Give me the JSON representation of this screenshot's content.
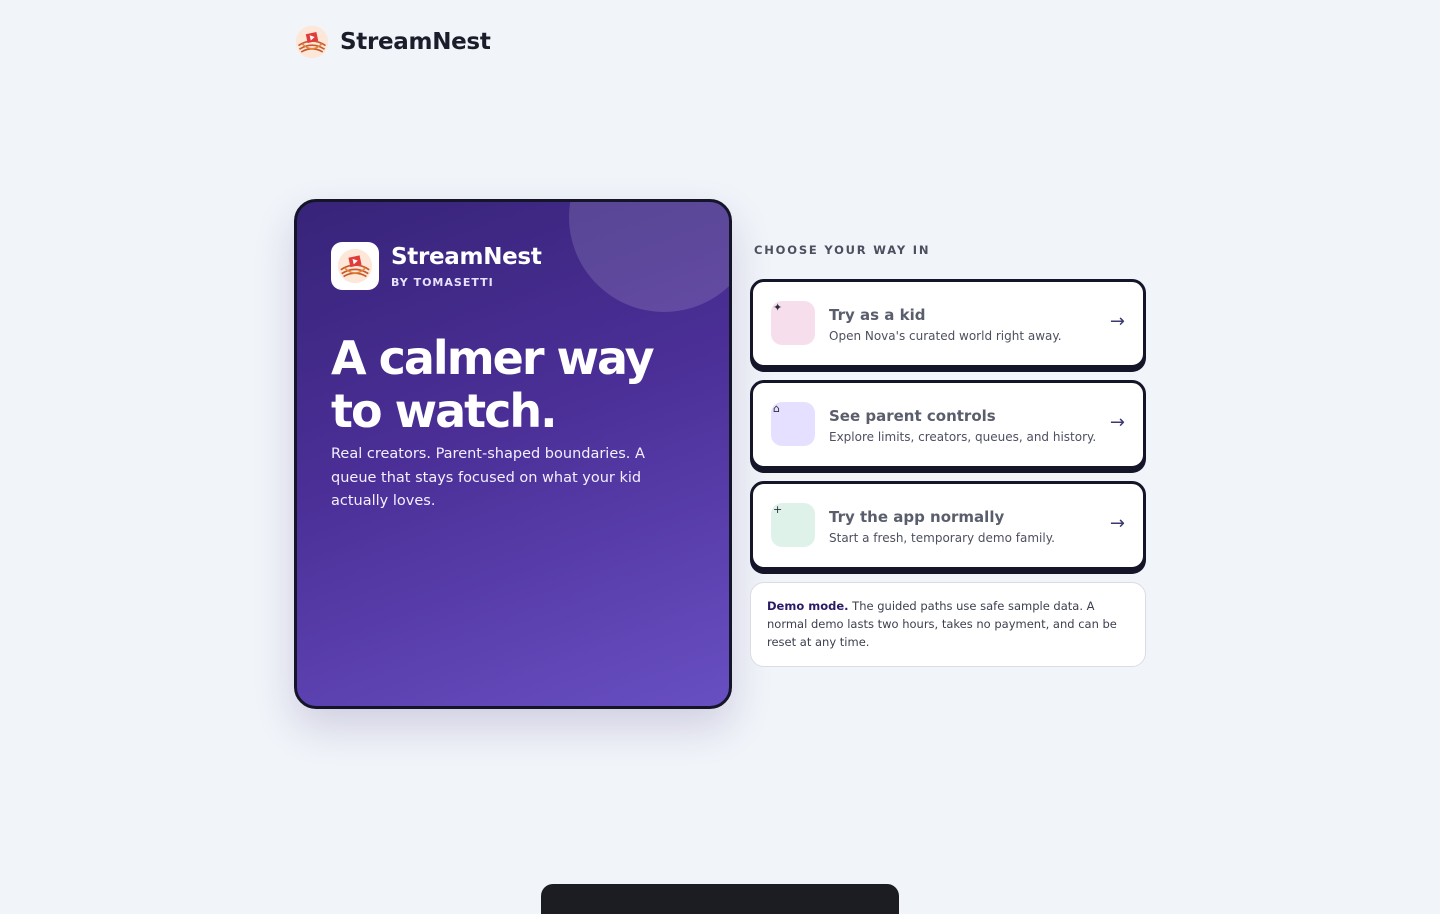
{
  "header": {
    "brand": "StreamNest",
    "logo_icon": "streamnest-nest-logo"
  },
  "hero": {
    "brand": "StreamNest",
    "byline": "BY TOMASETTI",
    "title": "A calmer way to watch.",
    "description": "Real creators. Parent-shaped boundaries. A queue that stays focused on what your kid actually loves.",
    "colors": {
      "gradient_start": "#372479",
      "gradient_end": "#684fc2"
    }
  },
  "choose": {
    "label": "CHOOSE YOUR WAY IN",
    "options": [
      {
        "title": "Try as a kid",
        "subtitle": "Open Nova's curated world right away.",
        "icon": "sparkle-icon",
        "glyph": "✦",
        "icon_bg": "#f6deed",
        "arrow": "→"
      },
      {
        "title": "See parent controls",
        "subtitle": "Explore limits, creators, queues, and history.",
        "icon": "home-icon",
        "glyph": "⌂",
        "icon_bg": "#e5e0ff",
        "arrow": "→"
      },
      {
        "title": "Try the app normally",
        "subtitle": "Start a fresh, temporary demo family.",
        "icon": "plus-icon",
        "glyph": "+",
        "icon_bg": "#dff2ea",
        "arrow": "→"
      }
    ]
  },
  "demo_note": {
    "label": "Demo mode.",
    "text": " The guided paths use safe sample data. A normal demo lasts two hours, takes no payment, and can be reset at any time."
  }
}
